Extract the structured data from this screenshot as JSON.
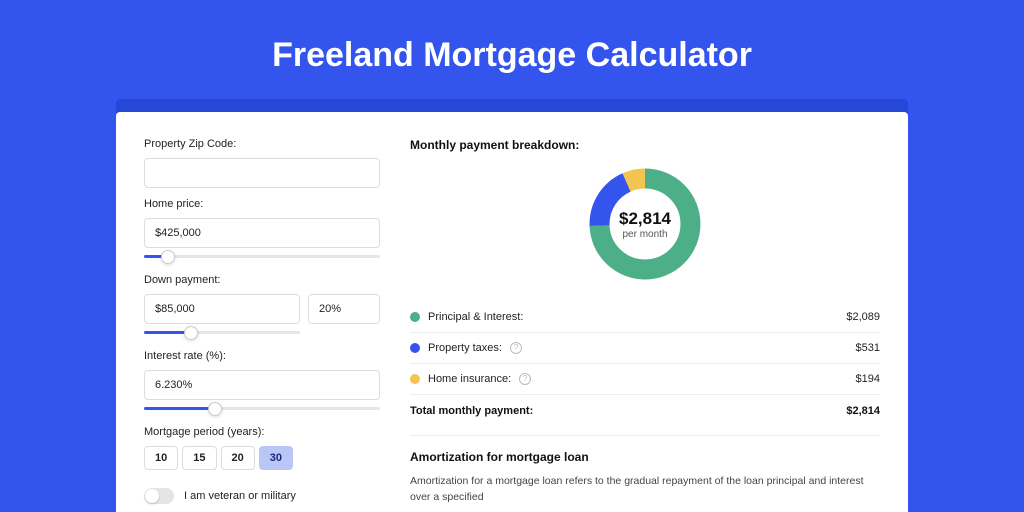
{
  "hero": {
    "title": "Freeland Mortgage Calculator"
  },
  "left": {
    "zip": {
      "label": "Property Zip Code:",
      "value": ""
    },
    "price": {
      "label": "Home price:",
      "value": "$425,000",
      "slider_pct": 10
    },
    "down": {
      "label": "Down payment:",
      "amount": "$85,000",
      "pct": "20%",
      "slider_pct": 20
    },
    "rate": {
      "label": "Interest rate (%):",
      "value": "6.230%",
      "slider_pct": 30
    },
    "period": {
      "label": "Mortgage period (years):",
      "options": [
        "10",
        "15",
        "20",
        "30"
      ],
      "selected": "30"
    },
    "veteran_label": "I am veteran or military"
  },
  "right": {
    "breakdown_title": "Monthly payment breakdown:",
    "center_amount": "$2,814",
    "center_sub": "per month",
    "items": [
      {
        "label": "Principal & Interest:",
        "value": "$2,089",
        "help": false
      },
      {
        "label": "Property taxes:",
        "value": "$531",
        "help": true
      },
      {
        "label": "Home insurance:",
        "value": "$194",
        "help": true
      }
    ],
    "total_label": "Total monthly payment:",
    "total_value": "$2,814",
    "amort_title": "Amortization for mortgage loan",
    "amort_text": "Amortization for a mortgage loan refers to the gradual repayment of the loan principal and interest over a specified"
  },
  "chart_data": {
    "type": "pie",
    "title": "Monthly payment breakdown",
    "series": [
      {
        "name": "Principal & Interest",
        "value": 2089,
        "color": "#4caf88"
      },
      {
        "name": "Property taxes",
        "value": 531,
        "color": "#3355ee"
      },
      {
        "name": "Home insurance",
        "value": 194,
        "color": "#f4c453"
      }
    ],
    "total": 2814
  }
}
